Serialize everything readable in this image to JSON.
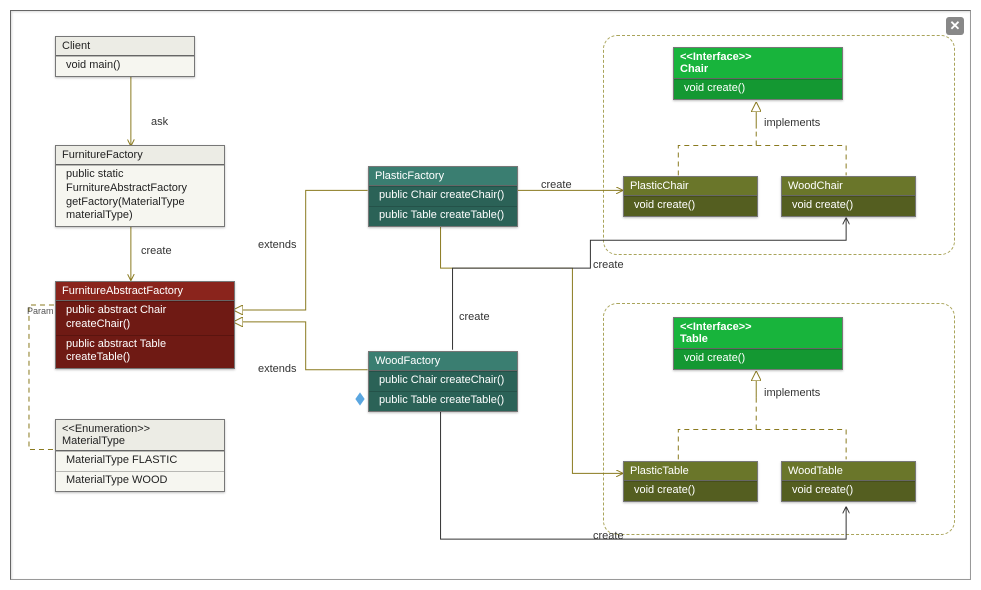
{
  "classes": {
    "client": {
      "name": "Client",
      "methods": [
        "void main()"
      ]
    },
    "furnitureFactory": {
      "name": "FurnitureFactory",
      "methods": [
        "public static FurnitureAbstractFactory getFactory(MaterialType materialType)"
      ]
    },
    "furnitureAbstractFactory": {
      "name": "FurnitureAbstractFactory",
      "methods": [
        "public abstract Chair createChair()",
        "public abstract Table createTable()"
      ]
    },
    "materialType": {
      "stereotype": "<<Enumeration>>",
      "name": "MaterialType",
      "values": [
        "MaterialType FLASTIC",
        "MaterialType WOOD"
      ]
    },
    "plasticFactory": {
      "name": "PlasticFactory",
      "methods": [
        "public Chair createChair()",
        "public Table createTable()"
      ]
    },
    "woodFactory": {
      "name": "WoodFactory",
      "methods": [
        "public Chair createChair()",
        "public Table createTable()"
      ]
    },
    "chair": {
      "stereotype": "<<Interface>>",
      "name": "Chair",
      "methods": [
        "void create()"
      ]
    },
    "plasticChair": {
      "name": "PlasticChair",
      "methods": [
        "void create()"
      ]
    },
    "woodChair": {
      "name": "WoodChair",
      "methods": [
        "void create()"
      ]
    },
    "table": {
      "stereotype": "<<Interface>>",
      "name": "Table",
      "methods": [
        "void create()"
      ]
    },
    "plasticTable": {
      "name": "PlasticTable",
      "methods": [
        "void create()"
      ]
    },
    "woodTable": {
      "name": "WoodTable",
      "methods": [
        "void create()"
      ]
    }
  },
  "labels": {
    "ask": "ask",
    "create": "create",
    "extends": "extends",
    "implements": "implements",
    "param": "Param"
  },
  "closeGlyph": "✕"
}
